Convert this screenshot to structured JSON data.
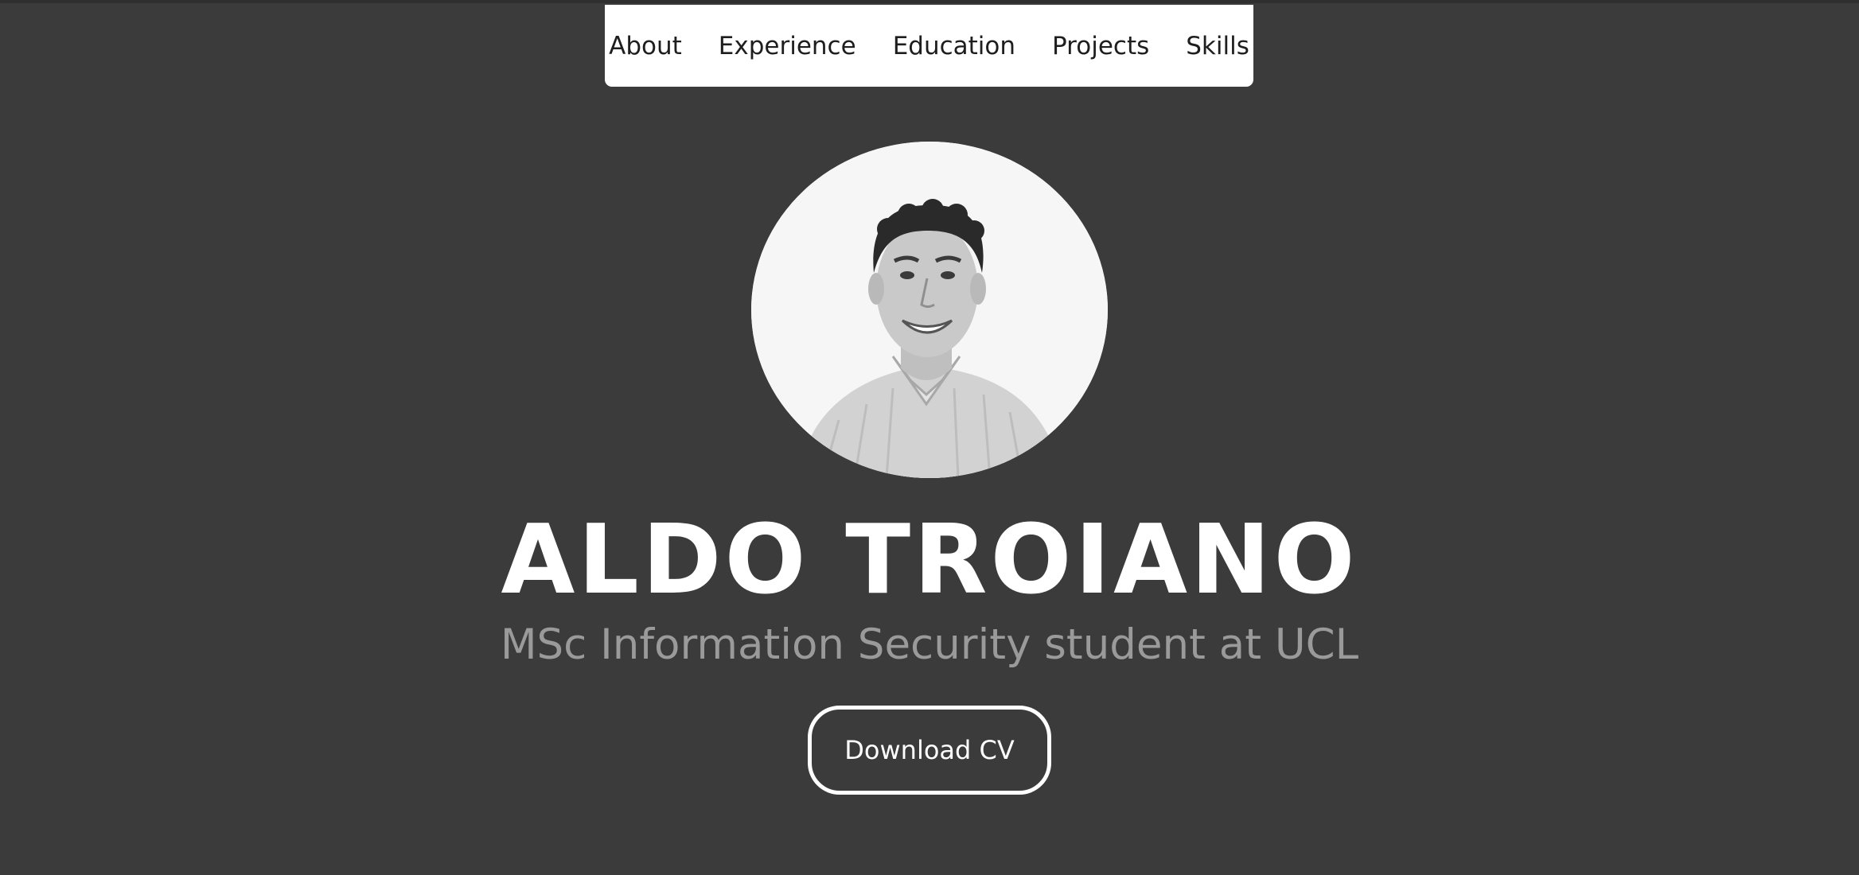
{
  "nav": {
    "items": [
      {
        "label": "About"
      },
      {
        "label": "Experience"
      },
      {
        "label": "Education"
      },
      {
        "label": "Projects"
      },
      {
        "label": "Skills"
      }
    ]
  },
  "hero": {
    "name": "ALDO TROIANO",
    "subtitle": "MSc Information Security student at UCL",
    "cv_button": "Download CV",
    "avatar_icon": "profile-photo"
  },
  "colors": {
    "background": "#3b3b3b",
    "nav_background": "#ffffff",
    "name": "#ffffff",
    "subtitle": "#9a9a9a",
    "button_border": "#ffffff"
  }
}
